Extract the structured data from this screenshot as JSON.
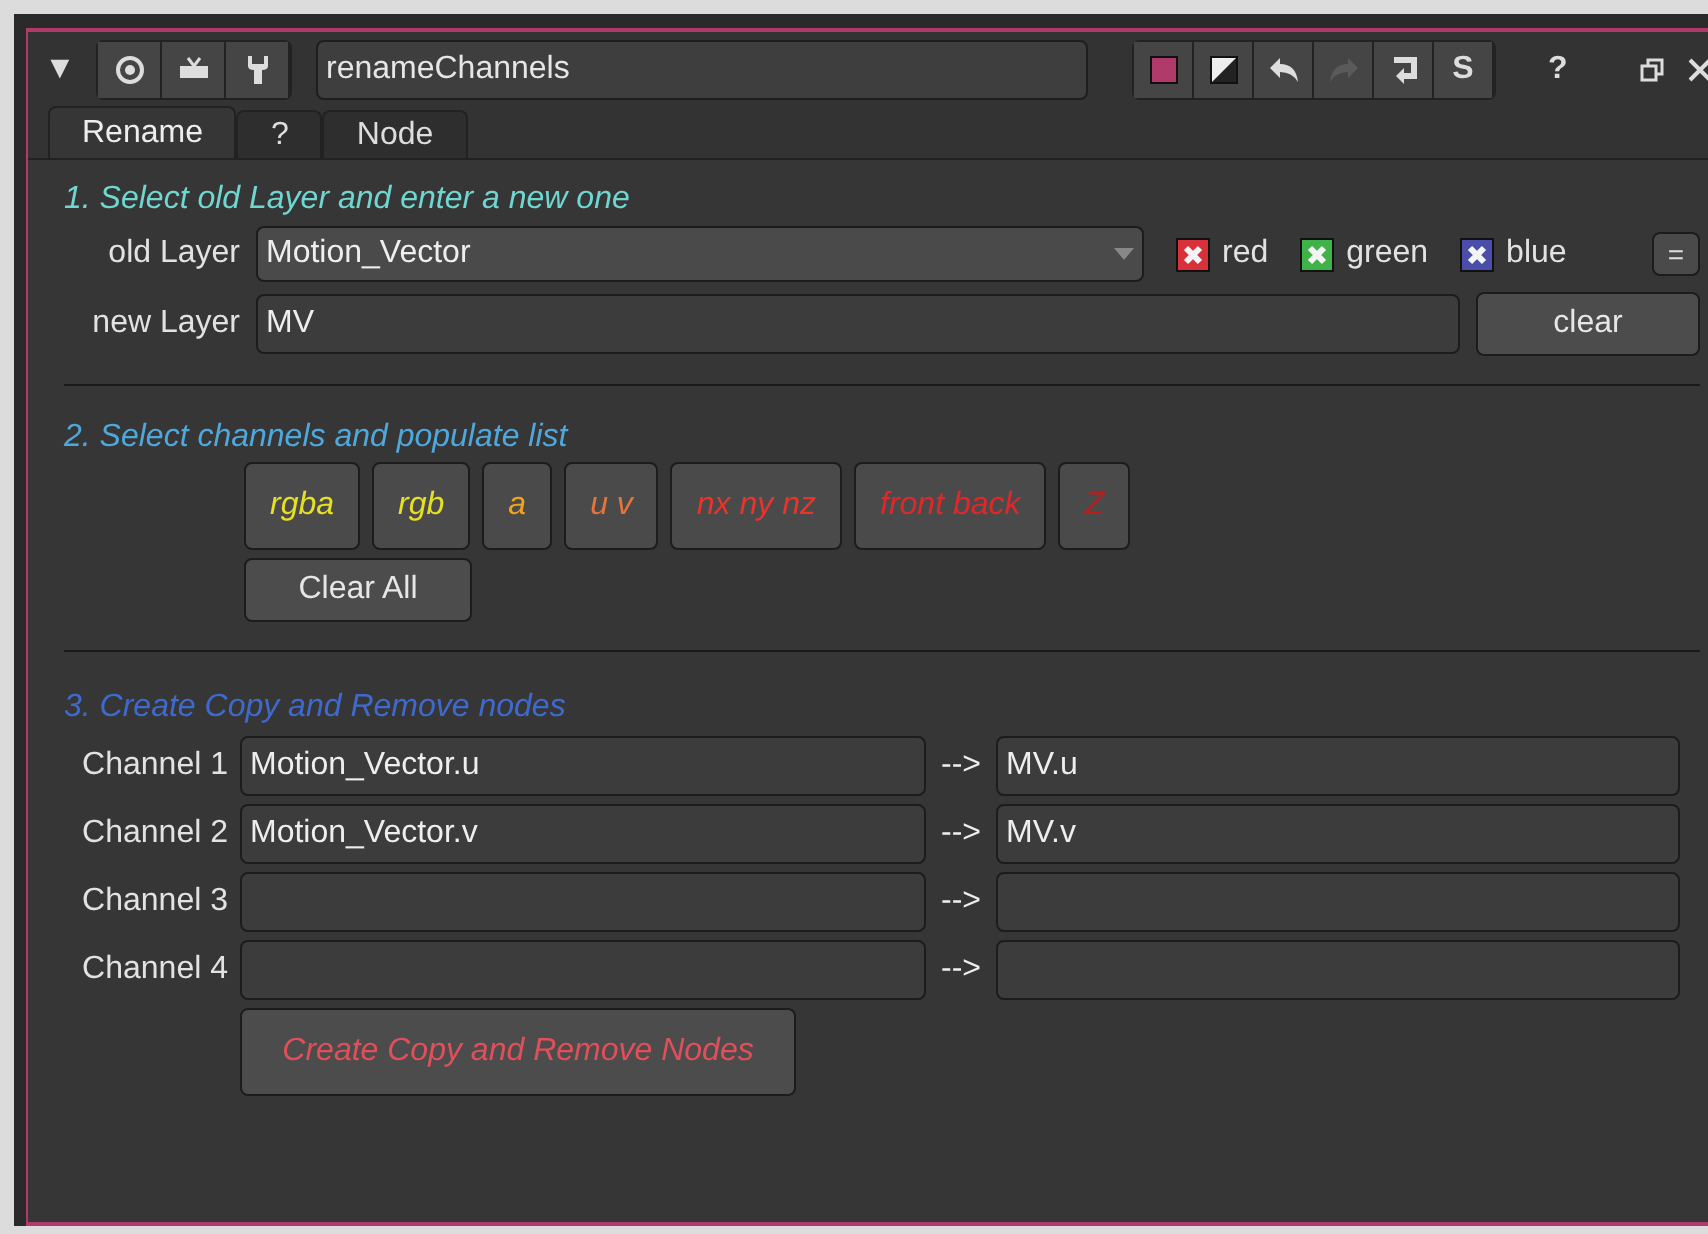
{
  "header": {
    "collapse": "▼",
    "node_name": "renameChannels",
    "help": "?",
    "buttons": [
      {
        "kind": "swatch"
      },
      {
        "kind": "diag"
      },
      {
        "kind": "undo",
        "disabled": false
      },
      {
        "kind": "redo",
        "disabled": true
      },
      {
        "kind": "revert"
      },
      {
        "kind": "s",
        "label": "S"
      }
    ]
  },
  "tabs": [
    {
      "label": "Rename",
      "selected": true
    },
    {
      "label": "?",
      "selected": false
    },
    {
      "label": "Node",
      "selected": false
    }
  ],
  "section_1": {
    "title": "1. Select old Layer and enter a new one",
    "old_layer_label": "old Layer",
    "old_layer": "Motion_Vector",
    "checks": [
      {
        "label": "red",
        "checked": true,
        "color": "#d8313a"
      },
      {
        "label": "green",
        "checked": true,
        "color": "#3fb34a"
      },
      {
        "label": "blue",
        "checked": true,
        "color": "#4a4ea8"
      }
    ],
    "equals": "=",
    "new_layer_label": "new Layer",
    "new_layer": "MV",
    "clear": "clear"
  },
  "section_2": {
    "title": "2. Select channels and populate list",
    "channel_buttons": [
      {
        "label": "rgba",
        "color": "#e6e024"
      },
      {
        "label": "rgb",
        "color": "#e6e024"
      },
      {
        "label": "a",
        "color": "#f0a21e"
      },
      {
        "label": "u v",
        "color": "#e8743a"
      },
      {
        "label": "nx ny nz",
        "color": "#e8342a"
      },
      {
        "label": "front back",
        "color": "#e0282a"
      },
      {
        "label": "Z",
        "color": "#b81e1e"
      }
    ],
    "clear_all": "Clear All"
  },
  "section_3": {
    "title": "3. Create Copy and Remove nodes",
    "rows": [
      {
        "label": "Channel 1",
        "from": "Motion_Vector.u",
        "arrow": "-->",
        "to": "MV.u"
      },
      {
        "label": "Channel 2",
        "from": "Motion_Vector.v",
        "arrow": "-->",
        "to": "MV.v"
      },
      {
        "label": "Channel 3",
        "arrow": "-->"
      },
      {
        "label": "Channel 4",
        "arrow": "-->"
      }
    ],
    "create": "Create Copy and Remove Nodes"
  }
}
